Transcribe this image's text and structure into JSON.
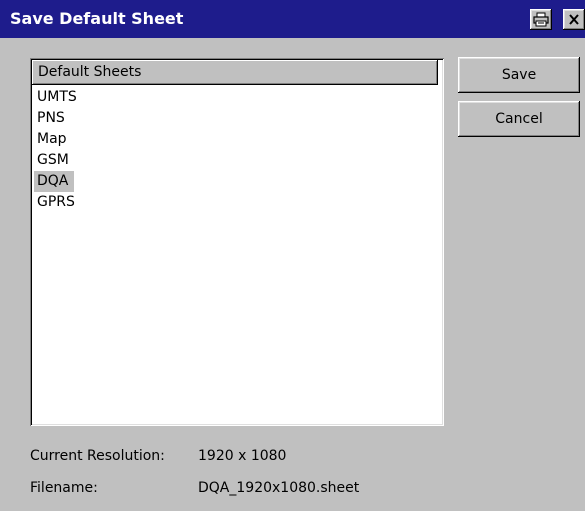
{
  "window": {
    "title": "Save Default Sheet",
    "title_color": "#1e1c8c"
  },
  "titlebar_buttons": [
    {
      "icon": "printer-icon"
    },
    {
      "icon": "close-icon"
    }
  ],
  "list": {
    "header": "Default Sheets",
    "items": [
      "UMTS",
      "PNS",
      "Map",
      "GSM",
      "DQA",
      "GPRS"
    ],
    "selected": "DQA"
  },
  "buttons": {
    "save": "Save",
    "cancel": "Cancel"
  },
  "info": {
    "resolution_label": "Current Resolution:",
    "resolution_value": "1920 x 1080",
    "filename_label": "Filename:",
    "filename_value": "DQA_1920x1080.sheet"
  }
}
